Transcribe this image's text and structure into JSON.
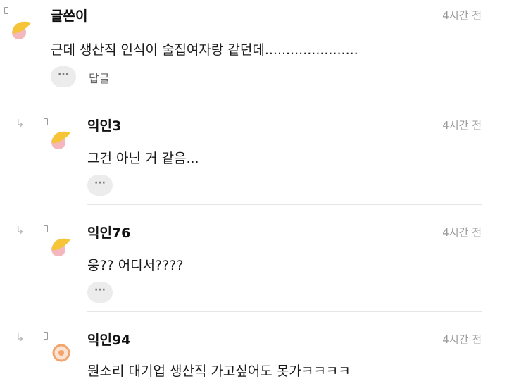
{
  "comments": [
    {
      "author": "글쓴이",
      "time": "4시간 전",
      "text": "근데 생산직 인식이 술집여자랑 같던데......................",
      "more": "···",
      "reply_label": "답글"
    },
    {
      "author": "익인3",
      "time": "4시간 전",
      "text": "그건 아닌 거 같음...",
      "more": "···"
    },
    {
      "author": "익인76",
      "time": "4시간 전",
      "text": "웅?? 어디서????",
      "more": "···"
    },
    {
      "author": "익인94",
      "time": "4시간 전",
      "text": "뭔소리 대기업 생산직 가고싶어도 못가ㅋㅋㅋㅋ"
    }
  ],
  "icons": {
    "reply_arrow": "↳",
    "avatar_yellow": "#f6c437",
    "avatar_pink": "#f4b7bd",
    "avatar_orange": "#f2a46b"
  }
}
